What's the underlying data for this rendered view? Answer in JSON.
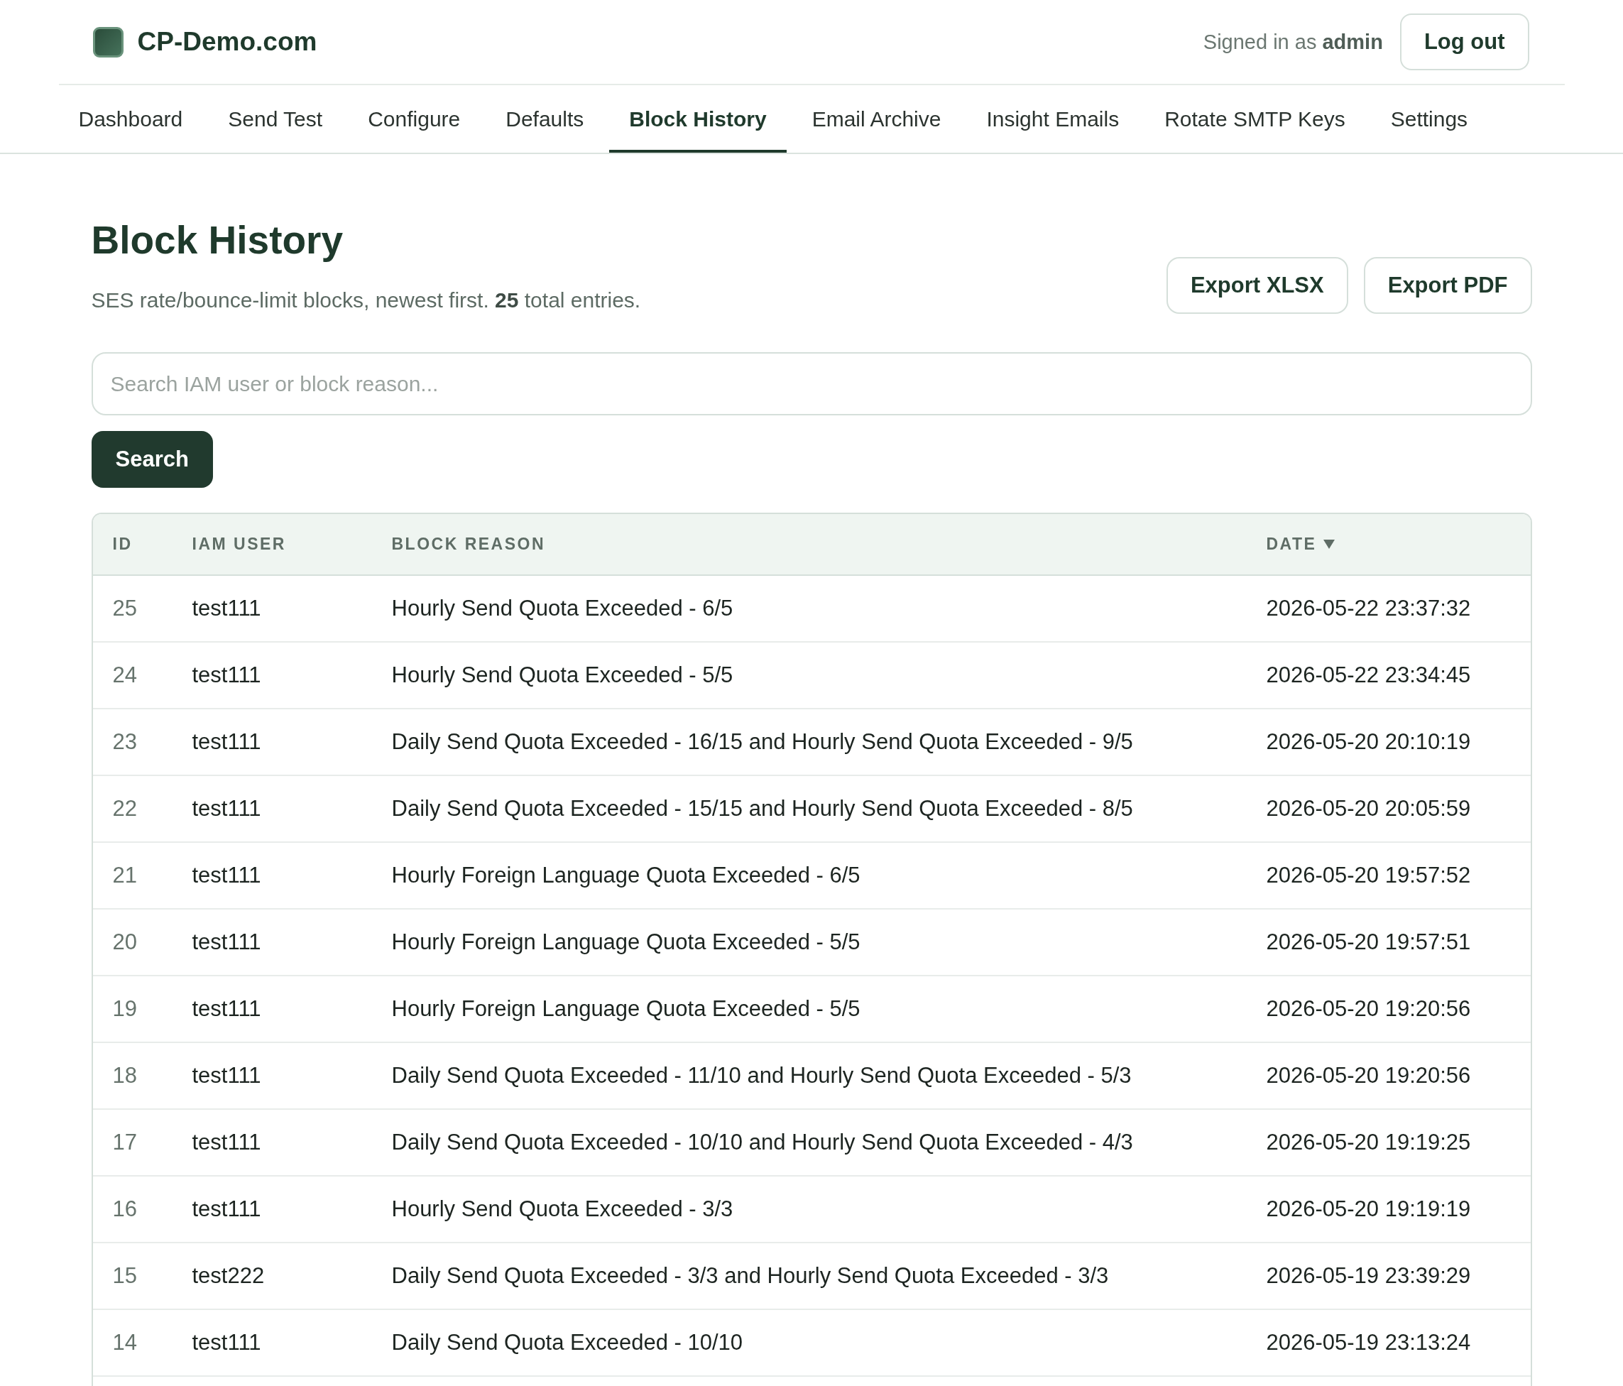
{
  "header": {
    "brand": "CP-Demo.com",
    "signed_in": "Signed in as **admin**",
    "logout_button": "Log out"
  },
  "nav": {
    "tabs": [
      {
        "label": "Dashboard",
        "selected": false
      },
      {
        "label": "Send Test",
        "selected": false
      },
      {
        "label": "Configure",
        "selected": false
      },
      {
        "label": "Defaults",
        "selected": false
      },
      {
        "label": "Block History",
        "selected": true
      },
      {
        "label": "Email Archive",
        "selected": false
      },
      {
        "label": "Insight Emails",
        "selected": false
      },
      {
        "label": "Rotate SMTP Keys",
        "selected": false
      },
      {
        "label": "Settings",
        "selected": false
      }
    ]
  },
  "page": {
    "title": "Block History",
    "subtitle": "SES rate/bounce-limit blocks, newest first. **25** total entries.",
    "actions": [
      "Export XLSX",
      "Export PDF"
    ]
  },
  "search": {
    "placeholder": "Search IAM user or block reason...",
    "button": "Search"
  },
  "table": {
    "columns": [
      {
        "label": "ID",
        "sorted": false
      },
      {
        "label": "IAM USER",
        "sorted": false
      },
      {
        "label": "BLOCK REASON",
        "sorted": false
      },
      {
        "label": "DATE",
        "sorted": true
      }
    ],
    "rows": [
      {
        "id": "25",
        "user": "test111",
        "reason": "Hourly Send Quota Exceeded - 6/5",
        "date": "2026-05-22 23:37:32"
      },
      {
        "id": "24",
        "user": "test111",
        "reason": "Hourly Send Quota Exceeded - 5/5",
        "date": "2026-05-22 23:34:45"
      },
      {
        "id": "23",
        "user": "test111",
        "reason": "Daily Send Quota Exceeded - 16/15 and Hourly Send Quota Exceeded - 9/5",
        "date": "2026-05-20 20:10:19"
      },
      {
        "id": "22",
        "user": "test111",
        "reason": "Daily Send Quota Exceeded - 15/15 and Hourly Send Quota Exceeded - 8/5",
        "date": "2026-05-20 20:05:59"
      },
      {
        "id": "21",
        "user": "test111",
        "reason": "Hourly Foreign Language Quota Exceeded - 6/5",
        "date": "2026-05-20 19:57:52"
      },
      {
        "id": "20",
        "user": "test111",
        "reason": "Hourly Foreign Language Quota Exceeded - 5/5",
        "date": "2026-05-20 19:57:51"
      },
      {
        "id": "19",
        "user": "test111",
        "reason": "Hourly Foreign Language Quota Exceeded - 5/5",
        "date": "2026-05-20 19:20:56"
      },
      {
        "id": "18",
        "user": "test111",
        "reason": "Daily Send Quota Exceeded - 11/10 and Hourly Send Quota Exceeded - 5/3",
        "date": "2026-05-20 19:20:56"
      },
      {
        "id": "17",
        "user": "test111",
        "reason": "Daily Send Quota Exceeded - 10/10 and Hourly Send Quota Exceeded - 4/3",
        "date": "2026-05-20 19:19:25"
      },
      {
        "id": "16",
        "user": "test111",
        "reason": "Hourly Send Quota Exceeded - 3/3",
        "date": "2026-05-20 19:19:19"
      },
      {
        "id": "15",
        "user": "test222",
        "reason": "Daily Send Quota Exceeded - 3/3 and Hourly Send Quota Exceeded - 3/3",
        "date": "2026-05-19 23:39:29"
      },
      {
        "id": "14",
        "user": "test111",
        "reason": "Daily Send Quota Exceeded - 10/10",
        "date": "2026-05-19 23:13:24"
      }
    ]
  }
}
